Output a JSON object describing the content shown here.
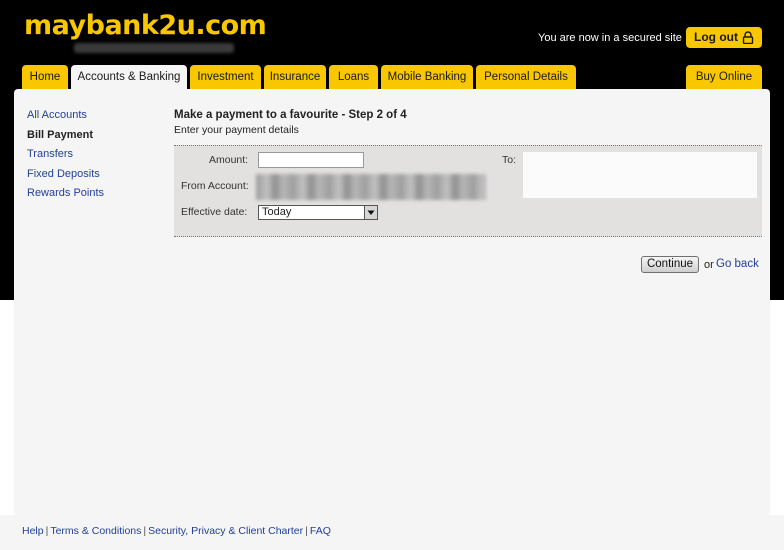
{
  "header": {
    "logo": "maybank2u.com",
    "secure_text": "You are now in a secured site",
    "logout_label": "Log out"
  },
  "tabs": [
    {
      "label": "Home"
    },
    {
      "label": "Accounts & Banking"
    },
    {
      "label": "Investment"
    },
    {
      "label": "Insurance"
    },
    {
      "label": "Loans"
    },
    {
      "label": "Mobile Banking"
    },
    {
      "label": "Personal Details"
    }
  ],
  "buy_online_label": "Buy Online",
  "sidebar": {
    "items": [
      {
        "label": "All Accounts"
      },
      {
        "label": "Bill Payment"
      },
      {
        "label": "Transfers"
      },
      {
        "label": "Fixed Deposits"
      },
      {
        "label": "Rewards Points"
      }
    ]
  },
  "form": {
    "title": "Make a payment to a favourite - Step 2 of 4",
    "subtitle": "Enter your payment details",
    "amount_label": "Amount:",
    "amount_value": "",
    "from_account_label": "From Account:",
    "effective_date_label": "Effective date:",
    "effective_date_value": "Today",
    "to_label": "To:"
  },
  "actions": {
    "continue_label": "Continue",
    "or_text": "or",
    "go_back_label": "Go back"
  },
  "footer": {
    "links": [
      {
        "label": "Help"
      },
      {
        "label": "Terms & Conditions"
      },
      {
        "label": "Security, Privacy & Client Charter"
      },
      {
        "label": "FAQ"
      }
    ]
  },
  "colors": {
    "brand_yellow": "#f8c700",
    "header_bg": "#000000",
    "link_blue": "#1f3f9a"
  }
}
